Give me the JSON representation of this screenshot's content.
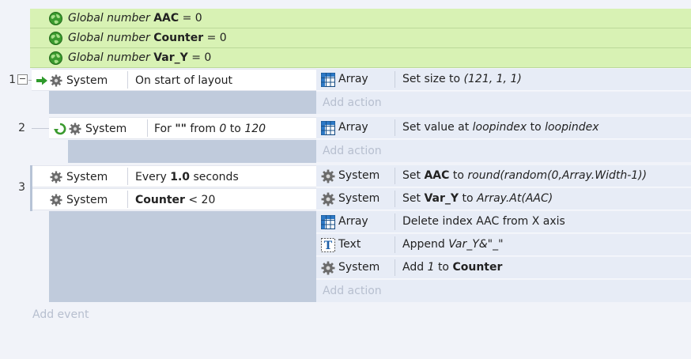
{
  "globals": [
    {
      "prefix": "Global number",
      "name": "AAC",
      "suffix": "= 0"
    },
    {
      "prefix": "Global number",
      "name": "Counter",
      "suffix": "= 0"
    },
    {
      "prefix": "Global number",
      "name": "Var_Y",
      "suffix": "= 0"
    }
  ],
  "events": [
    {
      "number": "1",
      "conditions": [
        {
          "object": "System",
          "text": "On start of layout"
        }
      ],
      "actions": [
        {
          "icon": "array-icon",
          "object": "Array",
          "text": "Set size to",
          "args": "(121, 1, 1)"
        }
      ]
    },
    {
      "number": "2",
      "conditions": [
        {
          "object": "System",
          "text_pre": "For",
          "quoted": "\"\"",
          "text_mid": "from",
          "from": "0",
          "text_to": "to",
          "to": "120"
        }
      ],
      "actions": [
        {
          "icon": "array-icon",
          "object": "Array",
          "pre": "Set value at",
          "a": "loopindex",
          "mid": "to",
          "b": "loopindex"
        }
      ]
    },
    {
      "number": "3",
      "conditions": [
        {
          "object": "System",
          "pre": "Every",
          "value": "1.0",
          "post": "seconds"
        },
        {
          "object": "System",
          "var": "Counter",
          "post": "< 20"
        }
      ],
      "actions": [
        {
          "icon": "gear-icon",
          "object": "System",
          "pre": "Set",
          "var": "AAC",
          "mid": "to",
          "expr": "round(random(0,Array.Width-1))"
        },
        {
          "icon": "gear-icon",
          "object": "System",
          "pre": "Set",
          "var": "Var_Y",
          "mid": "to",
          "expr": "Array.At(AAC)"
        },
        {
          "icon": "array-icon",
          "object": "Array",
          "text": "Delete index AAC from X axis"
        },
        {
          "icon": "text-icon",
          "object": "Text",
          "pre": "Append",
          "expr": "Var_Y&\"_\""
        },
        {
          "icon": "gear-icon",
          "object": "System",
          "pre": "Add",
          "num": "1",
          "mid": "to",
          "var": "Counter"
        }
      ]
    }
  ],
  "add_action_label": "Add action",
  "add_event_label": "Add event",
  "collapse_symbol": "−",
  "colors": {
    "global_bg": "#d8f2b4",
    "condition_bg": "#ffffff",
    "action_bg": "#e7ecf6",
    "empty_condition_bg": "#c0cbdc",
    "add_text": "#b7bfcf"
  }
}
